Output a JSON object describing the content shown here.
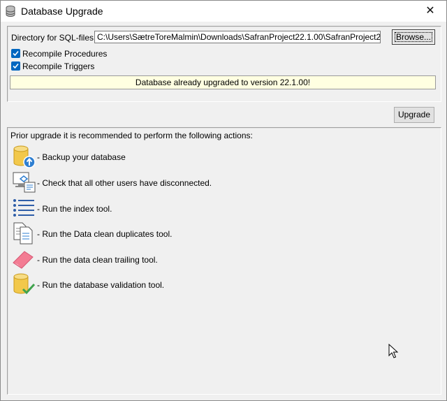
{
  "window": {
    "title": "Database Upgrade",
    "close_glyph": "✕"
  },
  "directory": {
    "label": "Directory for SQL-files:",
    "value": "C:\\Users\\SætreToreMalmin\\Downloads\\SafranProject22.1.00\\SafranProject2",
    "browse_label": "Browse..."
  },
  "options": [
    {
      "label": "Recompile Procedures",
      "checked": true
    },
    {
      "label": "Recompile Triggers",
      "checked": true
    }
  ],
  "status": {
    "message": "Database already upgraded to version 22.1.00!",
    "background": "#ffffe1"
  },
  "upgrade_label": "Upgrade",
  "instructions": {
    "intro": "Prior upgrade it is recommended to perform the following actions:",
    "actions": [
      {
        "icon": "database-backup-icon",
        "label": "-  Backup your database"
      },
      {
        "icon": "users-disconnect-icon",
        "label": "- Check that all other users have disconnected."
      },
      {
        "icon": "index-list-icon",
        "label": "- Run the index tool."
      },
      {
        "icon": "clean-duplicates-icon",
        "label": "- Run the Data clean duplicates tool."
      },
      {
        "icon": "eraser-icon",
        "label": "- Run the data clean trailing tool."
      },
      {
        "icon": "database-validate-icon",
        "label": "- Run the database validation tool."
      }
    ]
  },
  "colors": {
    "accent": "#0067c0",
    "db_yellow": "#f2c84b",
    "backup_blue": "#2f7fd1",
    "check_green": "#3fa34d",
    "eraser_pink": "#f37c93"
  }
}
